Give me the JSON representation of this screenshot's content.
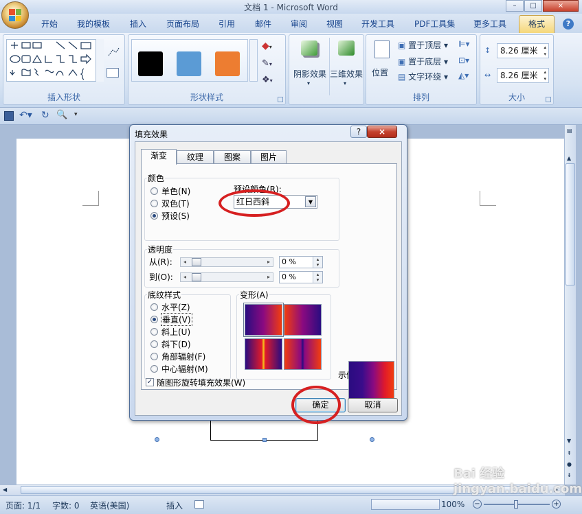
{
  "window": {
    "title": "文档 1 - Microsoft Word",
    "controls": [
      "–",
      "□",
      "×"
    ]
  },
  "ribbon_tabs": [
    "开始",
    "我的模板",
    "插入",
    "页面布局",
    "引用",
    "邮件",
    "审阅",
    "视图",
    "开发工具",
    "PDF工具集",
    "更多工具",
    "格式"
  ],
  "ribbon": {
    "insert_shapes_label": "插入形状",
    "shape_styles_label": "形状样式",
    "style_swatches": [
      "#000000",
      "#5b9bd5",
      "#ed7d31"
    ],
    "shadow_effects": "阴影效果",
    "threed_effects": "三维效果",
    "position": "位置",
    "bring_to_front": "置于顶层",
    "send_to_back": "置于底层",
    "text_wrap": "文字环绕",
    "arrange_label": "排列",
    "height": "8.26 厘米",
    "width": "8.26 厘米",
    "size_label": "大小"
  },
  "dialog": {
    "title": "填充效果",
    "help": "?",
    "close": "×",
    "tabs": [
      "渐变",
      "纹理",
      "图案",
      "图片"
    ],
    "colors_label": "颜色",
    "color_options": [
      "单色(N)",
      "双色(T)",
      "预设(S)"
    ],
    "preset_colors_label": "预设颜色(R):",
    "preset_value": "红日西斜",
    "transparency_label": "透明度",
    "from_label": "从(R):",
    "to_label": "到(O):",
    "from_value": "0 %",
    "to_value": "0 %",
    "shading_label": "底纹样式",
    "shading_options": [
      "水平(Z)",
      "垂直(V)",
      "斜上(U)",
      "斜下(D)",
      "角部辐射(F)",
      "中心辐射(M)"
    ],
    "variants_label": "变形(A)",
    "sample_label": "示例:",
    "rotate_checkbox": "随图形旋转填充效果(W)",
    "ok": "确定",
    "cancel": "取消"
  },
  "statusbar": {
    "page": "页面: 1/1",
    "words": "字数: 0",
    "language": "英语(美国)",
    "mode": "插入",
    "zoom": "100%"
  },
  "watermark": "Bai 经验 jingyan.baidu.com"
}
